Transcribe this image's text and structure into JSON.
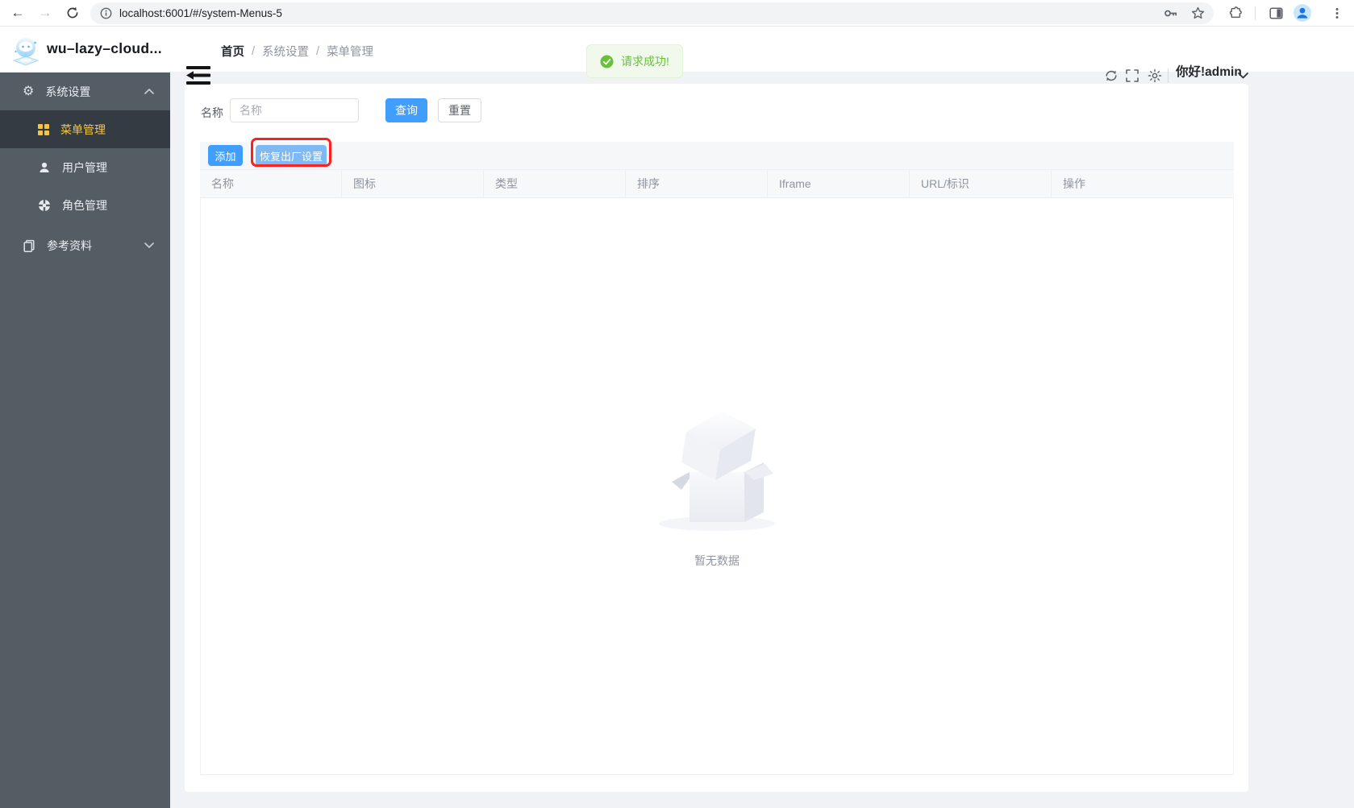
{
  "browser": {
    "url": "localhost:6001/#/system-Menus-5"
  },
  "header": {
    "app_title": "wu–lazy–cloud...",
    "breadcrumb": {
      "items": [
        "首页",
        "系统设置",
        "菜单管理"
      ],
      "separator": "/"
    },
    "user_greeting": "你好!admin"
  },
  "toast": {
    "message": "请求成功!"
  },
  "sidebar": {
    "groups": [
      {
        "label": "系统设置",
        "icon": "gear-icon",
        "state": "expanded",
        "children": [
          {
            "label": "菜单管理",
            "icon": "grid-icon",
            "active": true
          },
          {
            "label": "用户管理",
            "icon": "user-icon",
            "active": false
          },
          {
            "label": "角色管理",
            "icon": "segments-icon",
            "active": false
          }
        ]
      },
      {
        "label": "参考资料",
        "icon": "documents-icon",
        "state": "collapsed",
        "children": []
      }
    ]
  },
  "search": {
    "label": "名称",
    "placeholder": "名称",
    "value": "",
    "query_label": "查询",
    "reset_label": "重置"
  },
  "toolbar": {
    "add_label": "添加",
    "factory_reset_label": "恢复出厂设置",
    "factory_reset_highlighted": true
  },
  "table": {
    "columns": [
      "名称",
      "图标",
      "类型",
      "排序",
      "Iframe",
      "URL/标识",
      "操作"
    ],
    "rows": [],
    "empty_text": "暂无数据"
  },
  "colors": {
    "primary": "#409eff",
    "primary_light": "#7eb9f4",
    "success": "#67c23a",
    "success_bg": "#f0f9eb",
    "sidebar_bg": "#545c64",
    "sidebar_active_bg": "#353b42",
    "sidebar_active_text": "#f4c543",
    "highlight_outline": "#ff1f1f"
  }
}
